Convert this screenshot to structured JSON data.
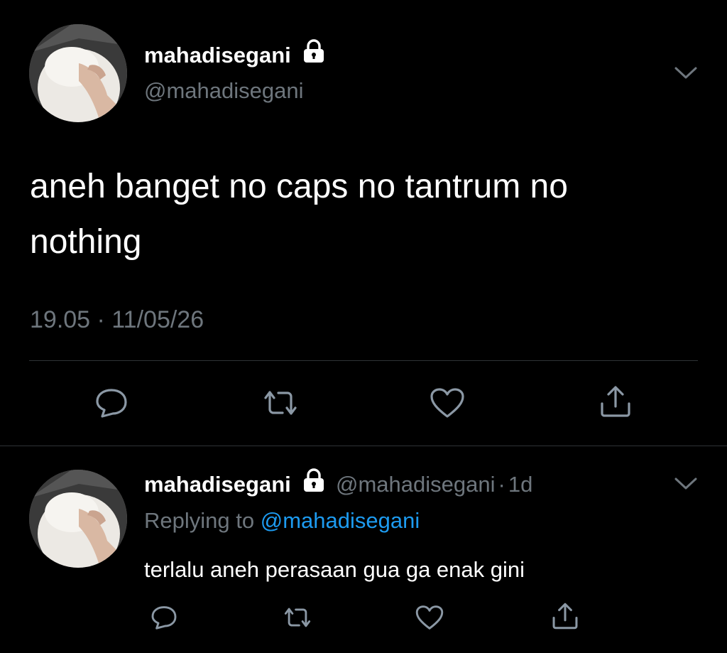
{
  "main_tweet": {
    "display_name": "mahadisegani",
    "handle": "@mahadisegani",
    "text_line1": "aneh banget no caps no tantrum no",
    "text_line2": "nothing",
    "timestamp": "19.05 · 11/05/26",
    "avatar_icon": "dog-avatar",
    "lock_icon": "lock-icon",
    "more_icon": "chevron-down-icon",
    "actions": [
      "reply-icon",
      "retweet-icon",
      "like-icon",
      "share-icon"
    ]
  },
  "reply_tweet": {
    "display_name": "mahadisegani",
    "handle": "@mahadisegani",
    "dot": "·",
    "age": "1d",
    "replying_prefix": "Replying to",
    "replying_handle": "@mahadisegani",
    "text": "terlalu aneh perasaan gua ga enak gini",
    "actions": [
      "reply-icon",
      "retweet-icon",
      "like-icon",
      "share-icon"
    ]
  },
  "colors": {
    "background": "#000000",
    "text": "#ffffff",
    "muted": "#6e767d",
    "link": "#1d9bf0",
    "divider": "#2f3336"
  }
}
